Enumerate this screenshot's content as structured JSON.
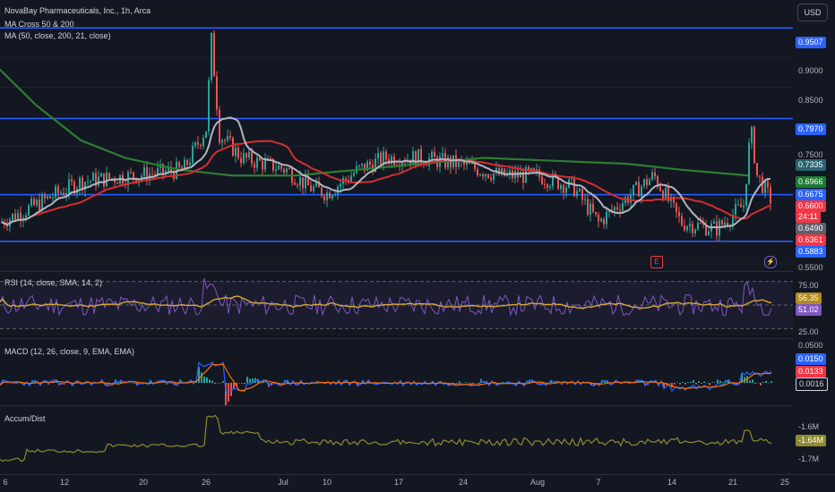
{
  "header": {
    "symbol_line": "NovaBay Pharmaceuticals, Inc., 1h, Arca",
    "ind1": "MA Cross 50 & 200",
    "ind2": "MA (50, close, 200, 21, close)",
    "currency": "USD"
  },
  "price_axis": {
    "ticks": [
      "0.9000",
      "0.8500",
      "0.7500",
      "0.5500"
    ],
    "tags": [
      {
        "text": "0.9507",
        "color": "#2962ff"
      },
      {
        "text": "0.7970",
        "color": "#2962ff"
      },
      {
        "text": "0.7335",
        "color": "#2a6470"
      },
      {
        "text": "0.6966",
        "color": "#1e7a32"
      },
      {
        "text": "0.6675",
        "color": "#2962ff"
      },
      {
        "text": "0.6600",
        "color": "#f23645"
      },
      {
        "text": "24:11",
        "color": "#f23645"
      },
      {
        "text": "0.6490",
        "color": "#5d606b"
      },
      {
        "text": "0.6361",
        "color": "#f23645"
      },
      {
        "text": "0.5883",
        "color": "#2962ff"
      }
    ],
    "levels": [
      0.9507,
      0.797,
      0.6675,
      0.5883
    ]
  },
  "rsi": {
    "label": "RSI (14, close, SMA, 14, 2)",
    "ticks": [
      "75.00",
      "25.00"
    ],
    "tags": [
      {
        "text": "56.35",
        "color": "#b38b1e"
      },
      {
        "text": "51.02",
        "color": "#7e57c2"
      }
    ]
  },
  "macd": {
    "label": "MACD (12, 26, close, 9, EMA, EMA)",
    "ticks": [
      "0.0500"
    ],
    "tags": [
      {
        "text": "0.0150",
        "color": "#2962ff"
      },
      {
        "text": "0.0133",
        "color": "#f23645"
      },
      {
        "text": "0.0016",
        "color": "#d1d4dc"
      }
    ]
  },
  "ad": {
    "label": "Accum/Dist",
    "ticks": [
      "-1.6M",
      "-1.7M"
    ],
    "tags": [
      {
        "text": "-1.64M",
        "color": "#8f8a32"
      }
    ]
  },
  "x_axis": [
    "6",
    "12",
    "20",
    "26",
    "Jul",
    "10",
    "17",
    "24",
    "Aug",
    "7",
    "14",
    "21",
    "25"
  ],
  "events": {
    "earnings": "E",
    "dividend": "⚡"
  },
  "colors": {
    "up": "#26a69a",
    "down": "#ef5350",
    "ma_fast": "#b2b5be",
    "ma_mid": "#d32f2f",
    "ma_slow": "#2e7d32",
    "level": "#2962ff",
    "rsi": "#7e57c2",
    "rsi_ma": "#d4a735",
    "macd": "#2962ff",
    "signal": "#ff6d00",
    "ad": "#8f8a32"
  }
}
